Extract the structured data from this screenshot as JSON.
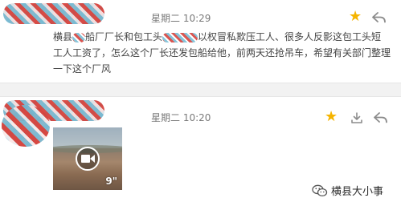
{
  "posts": [
    {
      "time": "星期二 10:29",
      "text_a": "横县",
      "text_b": "船厂厂长和包工头",
      "text_c": "以权冒私欺压工人、很多人反影这包工头短工人工资了，怎么这个厂长还发包船给他，前两天还抢吊车，希望有关部门整理一下这个厂风",
      "starred": true,
      "star_icon": "star-icon",
      "reply_icon": "reply-icon"
    },
    {
      "time": "星期二 10:20",
      "starred": true,
      "video_duration": "9\"",
      "star_icon": "star-icon",
      "download_icon": "download-icon",
      "reply_icon": "reply-icon"
    }
  ],
  "watermark": {
    "text": "横县大小事",
    "icon": "wechat-icon"
  },
  "colors": {
    "star": "#f5b400",
    "time": "#7a7a7a",
    "icon": "#8c8c8c"
  }
}
